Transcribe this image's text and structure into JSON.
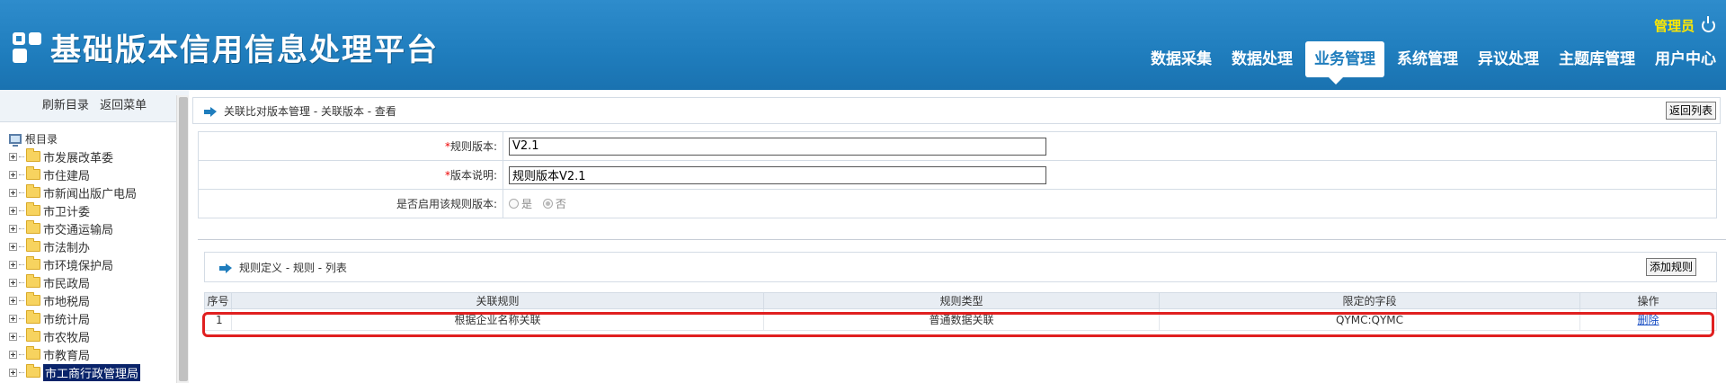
{
  "header": {
    "app_title": "基础版本信用信息处理平台",
    "user": "管理员",
    "nav": [
      "数据采集",
      "数据处理",
      "业务管理",
      "系统管理",
      "异议处理",
      "主题库管理",
      "用户中心"
    ],
    "active_nav": "业务管理"
  },
  "sidebar": {
    "refresh": "刷新目录",
    "back": "返回菜单",
    "root": "根目录",
    "items": [
      "市发展改革委",
      "市住建局",
      "市新闻出版广电局",
      "市卫计委",
      "市交通运输局",
      "市法制办",
      "市环境保护局",
      "市民政局",
      "市地税局",
      "市统计局",
      "市农牧局",
      "市教育局",
      "市工商行政管理局"
    ],
    "selected": "市工商行政管理局"
  },
  "main": {
    "breadcrumb": "关联比对版本管理 - 关联版本 - 查看",
    "back_button": "返回列表",
    "form": {
      "rule_version_label": "规则版本:",
      "rule_version_value": "V2.1",
      "version_desc_label": "版本说明:",
      "version_desc_value": "规则版本V2.1",
      "enable_label": "是否启用该规则版本:",
      "yes": "是",
      "no": "否",
      "required_mark": "*"
    },
    "rules_panel": {
      "breadcrumb": "规则定义 - 规则 - 列表",
      "add_button": "添加规则",
      "columns": [
        "序号",
        "关联规则",
        "规则类型",
        "限定的字段",
        "操作"
      ],
      "rows": [
        {
          "no": "1",
          "rule": "根据企业名称关联",
          "type": "普通数据关联",
          "field": "QYMC:QYMC",
          "action": "删除"
        }
      ]
    }
  }
}
